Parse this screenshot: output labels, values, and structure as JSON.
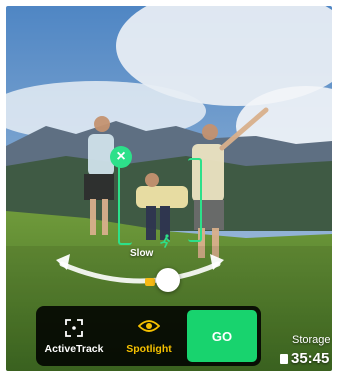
{
  "tracking": {
    "speed_label": "Slow"
  },
  "modes": {
    "items": [
      {
        "label": "ActiveTrack",
        "icon": "activetrack-frame-icon"
      },
      {
        "label": "Spotlight",
        "icon": "eye-icon"
      }
    ],
    "go_label": "GO"
  },
  "status": {
    "storage_label": "Storage",
    "storage_value": "35:45"
  },
  "colors": {
    "track_green": "#2de08a",
    "go_green": "#18d36e",
    "spotlight_yellow": "#f5c000",
    "slider_accent": "#f5b915"
  }
}
